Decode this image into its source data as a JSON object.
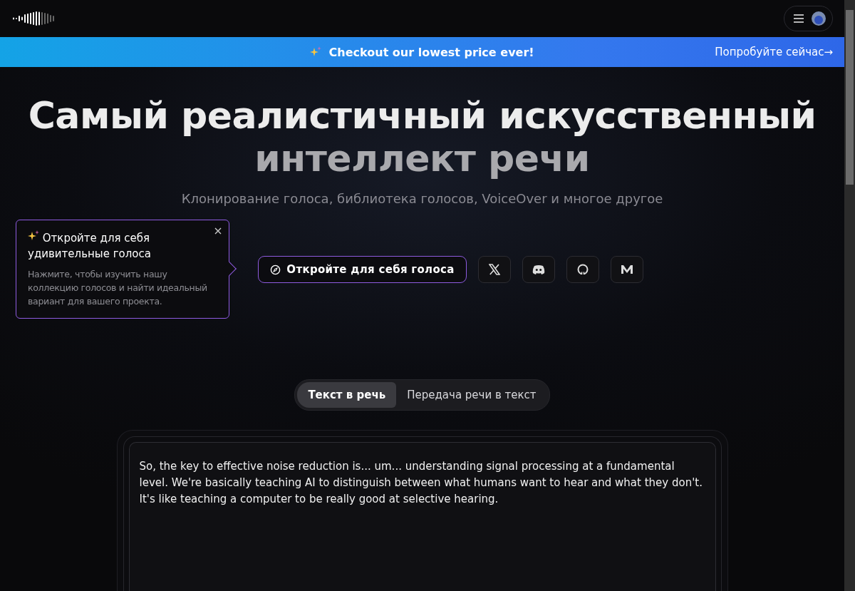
{
  "banner": {
    "text": "Checkout our lowest price ever!",
    "link": "Попробуйте сейчас→"
  },
  "hero": {
    "title_line_1": "Самый реалистичный искусственный",
    "title_line_2": "интеллект речи",
    "subtitle": "Клонирование голоса, библиотека голосов, VoiceOver и многое другое"
  },
  "tooltip": {
    "title": "Откройте для себя удивительные голоса",
    "text": "Нажмите, чтобы изучить нашу коллекцию голосов и найти идеальный вариант для вашего проекта."
  },
  "cta_button": "Откройте для себя голоса",
  "social_links": [
    {
      "kind": "x"
    },
    {
      "kind": "discord"
    },
    {
      "kind": "github"
    },
    {
      "kind": "medium"
    }
  ],
  "tabs": [
    {
      "label": "Текст в речь",
      "selected": true
    },
    {
      "label": "Передача речи в текст",
      "selected": false
    }
  ],
  "editor": {
    "value": "So, the key to effective noise reduction is... um... understanding signal processing at a fundamental level. We're basically teaching AI to distinguish between what humans want to hear and what they don't. It's like teaching a computer to be really good at selective hearing."
  }
}
